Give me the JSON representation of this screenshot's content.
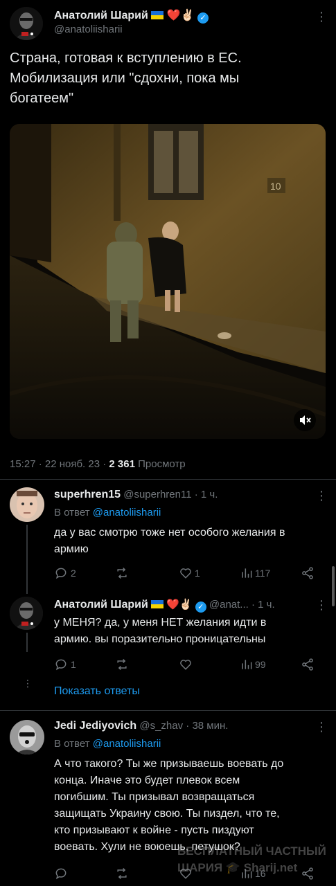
{
  "main": {
    "name": "Анатолий Шарий",
    "emoji": "❤️✌🏻",
    "handle": "@anatoliisharii",
    "text_lines": [
      "Страна, готовая к вступлению в ЕС.",
      "Мобилизация или \"сдохни, пока мы",
      "богатеем\""
    ],
    "meta_time": "15:27 · 22 нояб. 23 · ",
    "views_count": "2 361",
    "views_label": " Просмотр",
    "video_house_number": "10"
  },
  "replies": [
    {
      "name": "superhren15",
      "handle": "@superhren11",
      "time": "· 1 ч.",
      "reply_to_prefix": "В ответ ",
      "reply_to": "@anatoliisharii",
      "text_lines": [
        "да у вас смотрю тоже нет особого желания в",
        "армию"
      ],
      "stats": {
        "replies": "2",
        "retweets": "",
        "likes": "1",
        "views": "117"
      }
    },
    {
      "name": "Анатолий Шарий",
      "emoji": "❤️✌🏻",
      "handle": "@anat...",
      "time": "· 1 ч.",
      "text_lines": [
        "у МЕНЯ? да, у меня НЕТ желания идти в",
        "армию. вы поразительно проницательны"
      ],
      "stats": {
        "replies": "1",
        "retweets": "",
        "likes": "",
        "views": "99"
      }
    },
    {
      "name": "Jedi Jediyovich",
      "handle": "@s_zhav",
      "time": "· 38 мин.",
      "reply_to_prefix": "В ответ ",
      "reply_to": "@anatoliisharii",
      "text_lines": [
        "А что такого? Ты же призываешь воевать до",
        "конца. Иначе это будет плевок всем",
        "погибшим. Ты призывал возвращаться",
        "защищать Украину свою. Ты пиздел, что те,",
        "кто призывают к войне - пусть пиздуют",
        "воевать. Хули не воюешь, петушок?"
      ],
      "stats": {
        "replies": "",
        "retweets": "",
        "likes": "",
        "views": "16"
      }
    }
  ],
  "show_replies": "Показать ответы",
  "watermark": {
    "line1": "БЕСПЛАТНЫЙ ЧАСТНЫЙ",
    "line2": "ШАРИЯ",
    "line3": "Sharij.net"
  }
}
